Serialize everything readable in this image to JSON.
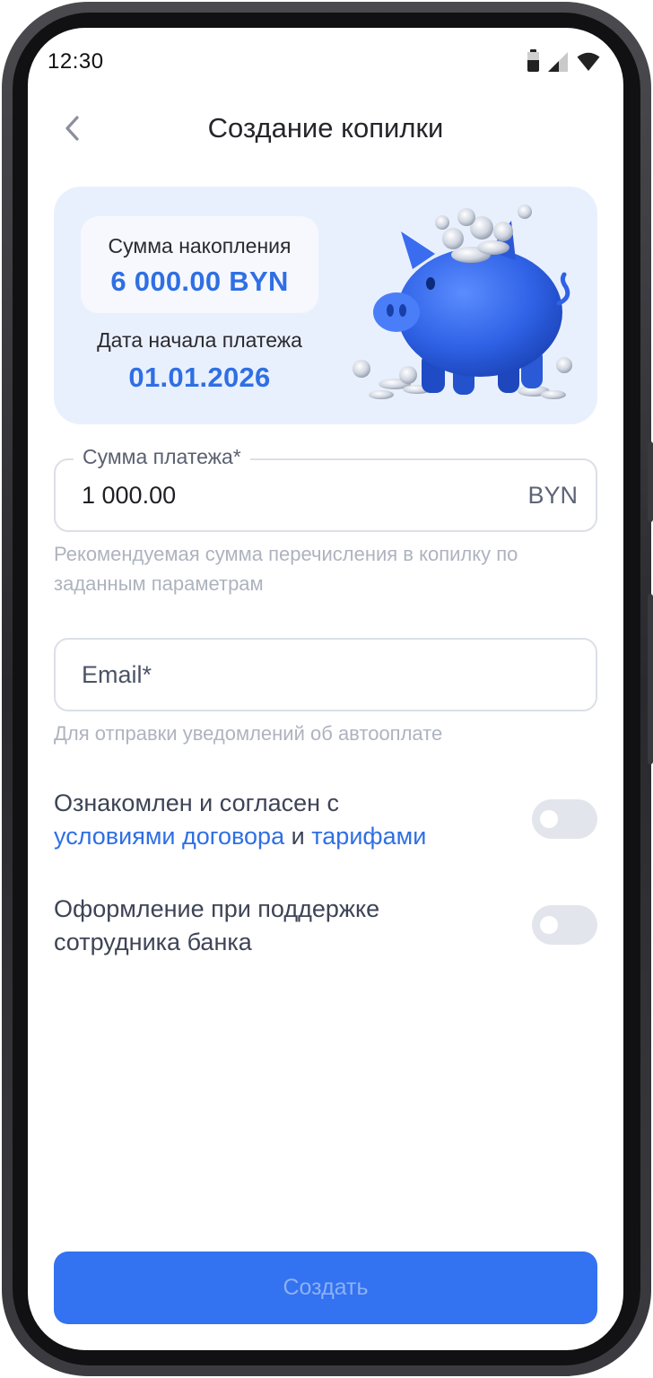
{
  "status_bar": {
    "time": "12:30",
    "icons": [
      "battery-icon",
      "signal-icon",
      "wifi-icon"
    ]
  },
  "header": {
    "title": "Создание копилки",
    "back_icon": "chevron-left-icon"
  },
  "summary": {
    "amount_label": "Сумма накопления",
    "amount_value": "6 000.00 BYN",
    "date_label": "Дата начала платежа",
    "date_value": "01.01.2026",
    "illustration": "piggy-bank-icon"
  },
  "payment_field": {
    "label": "Сумма платежа*",
    "value": "1 000.00",
    "suffix": "BYN",
    "hint": "Рекомендуемая сумма перечисления в копилку по заданным параметрам"
  },
  "email_field": {
    "placeholder": "Email*",
    "value": "",
    "hint": "Для отправки уведомлений об автооплате"
  },
  "agreement": {
    "text_before": "Ознакомлен и согласен с",
    "link_terms": "условиями договора",
    "conjunction": "и",
    "link_tariffs": "тарифами",
    "enabled": false
  },
  "bank_assist": {
    "text": "Оформление при поддержке сотрудника банка",
    "enabled": false
  },
  "create_button": {
    "label": "Создать",
    "enabled": false
  },
  "colors": {
    "accent": "#2f6fe4",
    "card_bg": "#e9f0fd",
    "button_bg": "#3372f0",
    "button_text_disabled": "#8db1f6",
    "toggle_off": "#e3e5ec",
    "hint_text": "#aeb3bf"
  }
}
